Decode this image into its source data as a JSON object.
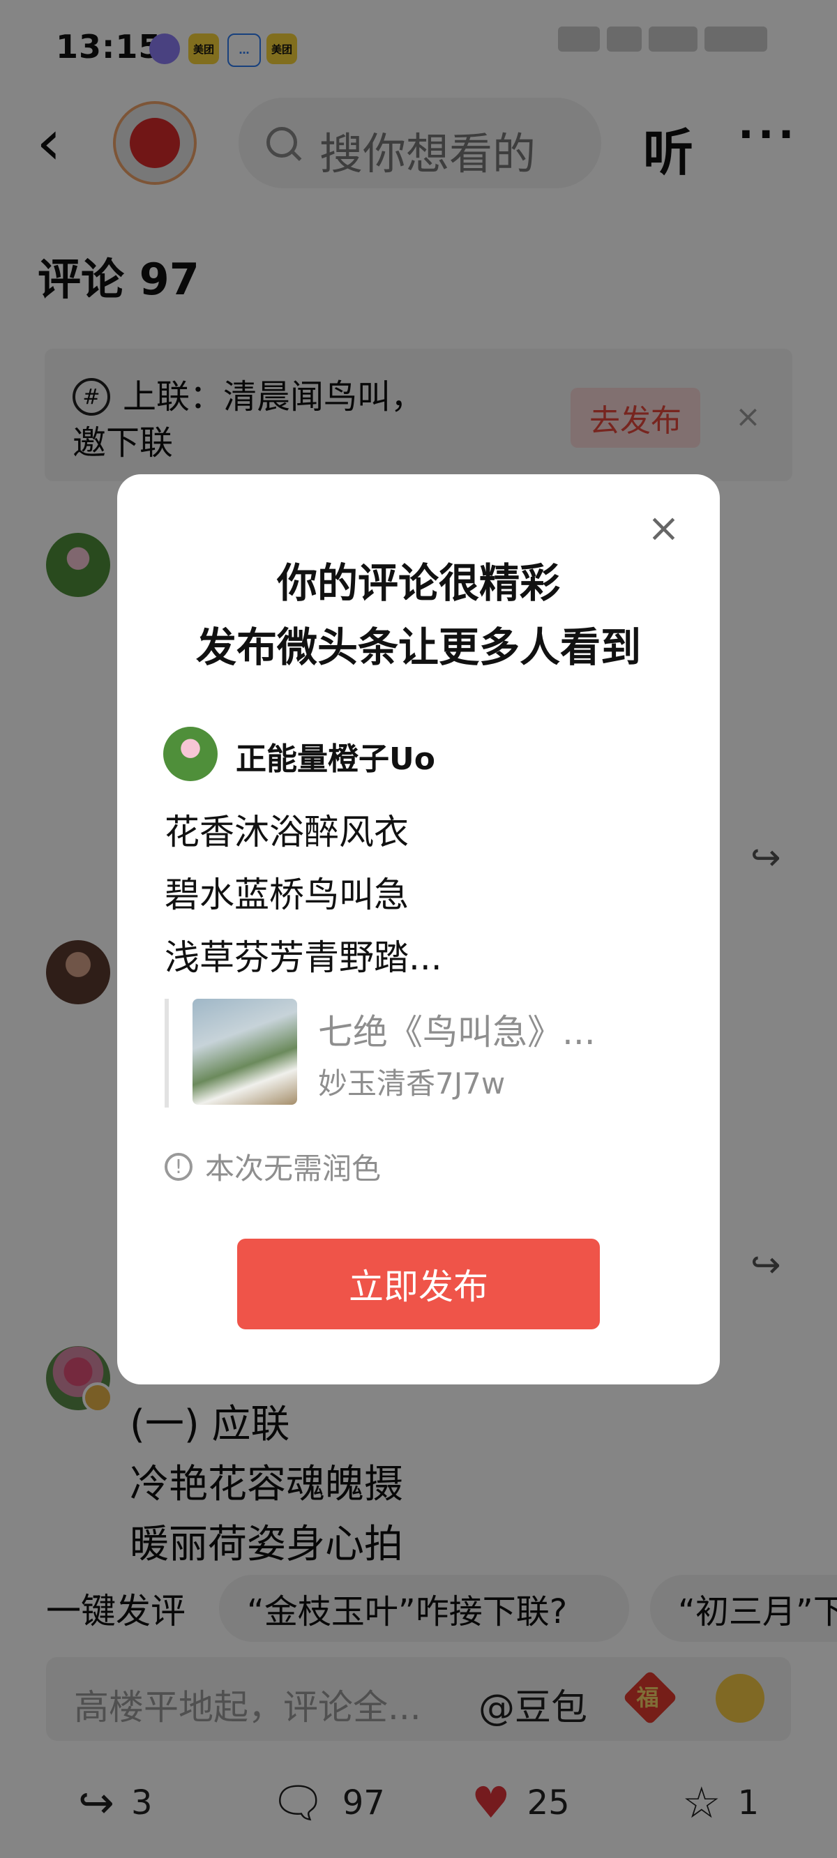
{
  "status_bar": {
    "time": "13:15",
    "app_icons": [
      "美团",
      "美团"
    ]
  },
  "header": {
    "search_placeholder": "搜你想看的",
    "listen_label": "听",
    "more_label": "···"
  },
  "comments_section": {
    "title": "评论 97",
    "couplet_banner": {
      "text_line1": "上联：清晨闻鸟叫，",
      "text_line2": "邀下联",
      "action_label": "去发布",
      "close_label": "×"
    },
    "reply_lines": [
      "(一) 应联",
      "冷艳花容魂魄摄",
      "暖丽荷姿身心拍"
    ]
  },
  "quick_comment": {
    "label": "一键发评",
    "chips": [
      "“金枝玉叶”咋接下联?",
      "“初三月”下"
    ]
  },
  "input_bar": {
    "placeholder": "高楼平地起，评论全...",
    "mention": "@豆包",
    "fu_label": "福"
  },
  "bottom_actions": {
    "share_count": "3",
    "comment_count": "97",
    "like_count": "25",
    "favorite_count": "1"
  },
  "modal": {
    "close_label": "×",
    "title_line1": "你的评论很精彩",
    "title_line2": "发布微头条让更多人看到",
    "author": "正能量橙子Uo",
    "poem_lines": [
      "花香沐浴醉风衣",
      "碧水蓝桥鸟叫急",
      "浅草芬芳青野踏..."
    ],
    "quote_title": "七绝《鸟叫急》...",
    "quote_author": "妙玉清香7J7w",
    "note": "本次无需润色",
    "publish_button": "立即发布"
  },
  "colors": {
    "accent_red": "#ef5449",
    "like_red": "#e0343b",
    "overlay": "rgba(0,0,0,0.48)"
  }
}
